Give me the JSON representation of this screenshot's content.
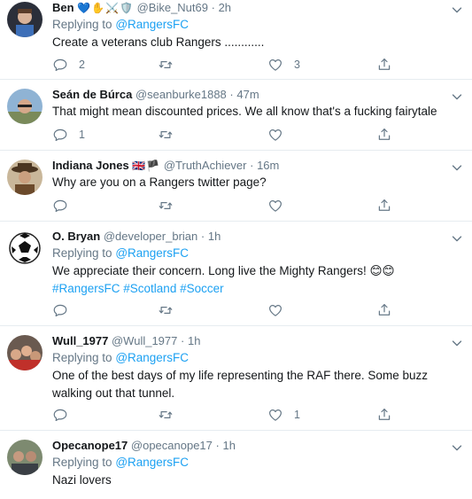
{
  "tweets": [
    {
      "name": "Ben",
      "name_emojis": "💙✋⚔️🛡️",
      "handle": "@Bike_Nut69",
      "separator": "·",
      "time": "2h",
      "replying_prefix": "Replying to",
      "replying_mention": "@RangersFC",
      "text": "Create a veterans club Rangers ............",
      "reply_count": "2",
      "retweet_count": "",
      "like_count": "3"
    },
    {
      "name": "Seán de Búrca",
      "handle": "@seanburke1888",
      "separator": "·",
      "time": "47m",
      "text": "That might mean discounted prices. We all know that's a fucking fairytale",
      "reply_count": "1",
      "retweet_count": "",
      "like_count": ""
    },
    {
      "name": "Indiana Jones",
      "name_emojis": "🇬🇧🏴",
      "handle": "@TruthAchiever",
      "separator": "·",
      "time": "16m",
      "text": "Why are you on a Rangers twitter page?",
      "reply_count": "",
      "retweet_count": "",
      "like_count": ""
    },
    {
      "name": "O. Bryan",
      "handle": "@developer_brian",
      "separator": "·",
      "time": "1h",
      "replying_prefix": "Replying to",
      "replying_mention": "@RangersFC",
      "text": "We appreciate their concern. Long live the Mighty Rangers! 😊😊",
      "hashtags": "#RangersFC #Scotland #Soccer",
      "reply_count": "",
      "retweet_count": "",
      "like_count": ""
    },
    {
      "name": "Wull_1977",
      "handle": "@Wull_1977",
      "separator": "·",
      "time": "1h",
      "replying_prefix": "Replying to",
      "replying_mention": "@RangersFC",
      "text_line1": "One of the best days of my life representing the RAF there. Some buzz",
      "text_line2": "walking out that tunnel.",
      "reply_count": "",
      "retweet_count": "",
      "like_count": "1"
    },
    {
      "name": "Opecanope17",
      "handle": "@opecanope17",
      "separator": "·",
      "time": "1h",
      "replying_prefix": "Replying to",
      "replying_mention": "@RangersFC",
      "text": "Nazi lovers"
    }
  ],
  "colors": {
    "link": "#1da1f2",
    "secondary_text": "#657786",
    "divider": "#e6ecf0"
  }
}
